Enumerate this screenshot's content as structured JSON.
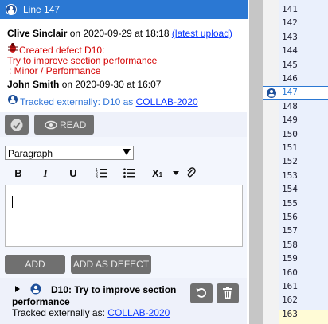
{
  "panel": {
    "title": "Line 147",
    "comment1": {
      "author": "Clive Sinclair",
      "on_text": "on 2020-09-29 at 18:18",
      "link": "(latest upload)"
    },
    "defect_created": {
      "line1": "Created defect D10:",
      "line2": "Try to improve section performance",
      "line3": ": Minor / Performance"
    },
    "comment2": {
      "author": "John Smith",
      "on_text": "on 2020-09-30 at 16:07"
    },
    "tracked": {
      "text": "Tracked externally: D10 as",
      "link": "COLLAB-2020"
    },
    "read_button": "READ",
    "format_select": "Paragraph",
    "toolbar": {
      "bold": "B",
      "italic": "I",
      "underline": "U",
      "subscript": "X",
      "subscript_sub": "1"
    },
    "add_button": "ADD",
    "add_as_defect_button": "ADD AS DEFECT",
    "defect_item": {
      "title": "D10: Try to improve section",
      "title_cont": "performance",
      "tracked_text": "Tracked externally as:",
      "tracked_link": "COLLAB-2020"
    }
  },
  "gutter": {
    "lines": [
      "141",
      "142",
      "143",
      "144",
      "145",
      "146",
      "147",
      "148",
      "149",
      "150",
      "151",
      "152",
      "153",
      "154",
      "155",
      "156",
      "157",
      "158",
      "159",
      "160",
      "161",
      "162",
      "163"
    ],
    "highlighted_line": "147"
  },
  "colors": {
    "titlebar": "#2b78d3",
    "dark_button": "#707070",
    "link": "#0b37ff",
    "defect_red": "#d40000",
    "tracked_blue": "#2f74d8"
  },
  "icons": [
    "bug-tracker-icon",
    "red-bug-icon",
    "check-icon",
    "eye-icon",
    "undo-icon",
    "trash-icon"
  ]
}
